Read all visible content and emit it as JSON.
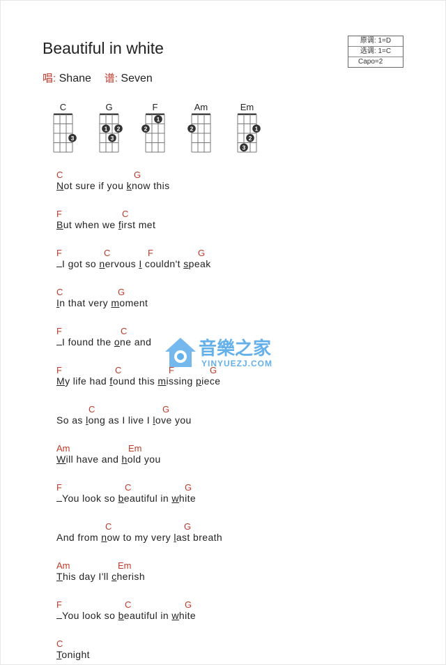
{
  "song": {
    "title": "Beautiful in white",
    "singer_label": "唱:",
    "singer": "Shane",
    "tab_label": "谱:",
    "tab_by": "Seven"
  },
  "key_info": {
    "original": "原调: 1=D",
    "selected": "选调: 1=C",
    "capo": "Capo=2"
  },
  "chord_diagrams": [
    {
      "name": "C",
      "fingers": [
        {
          "string": 4,
          "fret": 3,
          "finger": "3"
        }
      ]
    },
    {
      "name": "G",
      "fingers": [
        {
          "string": 2,
          "fret": 2,
          "finger": "1"
        },
        {
          "string": 4,
          "fret": 2,
          "finger": "2"
        },
        {
          "string": 3,
          "fret": 3,
          "finger": "3"
        }
      ]
    },
    {
      "name": "F",
      "fingers": [
        {
          "string": 3,
          "fret": 1,
          "finger": "1"
        },
        {
          "string": 1,
          "fret": 2,
          "finger": "2"
        }
      ]
    },
    {
      "name": "Am",
      "fingers": [
        {
          "string": 1,
          "fret": 2,
          "finger": "2"
        }
      ]
    },
    {
      "name": "Em",
      "fingers": [
        {
          "string": 4,
          "fret": 2,
          "finger": "1"
        },
        {
          "string": 3,
          "fret": 3,
          "finger": "2"
        },
        {
          "string": 2,
          "fret": 4,
          "finger": "3"
        }
      ]
    }
  ],
  "lyrics": [
    {
      "chords": [
        {
          "c": "C",
          "at": 0
        },
        {
          "c": "G",
          "at": 111
        }
      ],
      "segments": [
        {
          "t": "N",
          "u": true
        },
        {
          "t": "ot sure if you "
        },
        {
          "t": "k",
          "u": true
        },
        {
          "t": "now this"
        }
      ]
    },
    {
      "chords": [
        {
          "c": "F",
          "at": 0
        },
        {
          "c": "C",
          "at": 94
        }
      ],
      "segments": [
        {
          "t": "B",
          "u": true
        },
        {
          "t": "ut when we "
        },
        {
          "t": "f",
          "u": true
        },
        {
          "t": "irst met"
        }
      ]
    },
    {
      "chords": [
        {
          "c": "F",
          "at": 0
        },
        {
          "c": "C",
          "at": 68
        },
        {
          "c": "F",
          "at": 131
        },
        {
          "c": "G",
          "at": 203
        }
      ],
      "segments": [
        {
          "t": "",
          "dash": true
        },
        {
          "t": "I got so "
        },
        {
          "t": "n",
          "u": true
        },
        {
          "t": "ervous "
        },
        {
          "t": "I",
          "u": true
        },
        {
          "t": " couldn't "
        },
        {
          "t": "s",
          "u": true
        },
        {
          "t": "peak"
        }
      ]
    },
    {
      "chords": [
        {
          "c": "C",
          "at": 0
        },
        {
          "c": "G",
          "at": 88
        }
      ],
      "segments": [
        {
          "t": "I",
          "u": true
        },
        {
          "t": "n that very "
        },
        {
          "t": "m",
          "u": true
        },
        {
          "t": "oment"
        }
      ]
    },
    {
      "chords": [
        {
          "c": "F",
          "at": 0
        },
        {
          "c": "C",
          "at": 92
        }
      ],
      "segments": [
        {
          "t": "",
          "dash": true
        },
        {
          "t": "I found the "
        },
        {
          "t": "o",
          "u": true
        },
        {
          "t": "ne and"
        }
      ]
    },
    {
      "chords": [
        {
          "c": "F",
          "at": 0
        },
        {
          "c": "C",
          "at": 84
        },
        {
          "c": "F",
          "at": 161
        },
        {
          "c": "G",
          "at": 220
        }
      ],
      "segments": [
        {
          "t": "M",
          "u": true
        },
        {
          "t": "y life had "
        },
        {
          "t": "f",
          "u": true
        },
        {
          "t": "ound this "
        },
        {
          "t": "m",
          "u": true
        },
        {
          "t": "issing "
        },
        {
          "t": "p",
          "u": true
        },
        {
          "t": "iece"
        }
      ]
    },
    {
      "chords": [
        {
          "c": "C",
          "at": 46
        },
        {
          "c": "G",
          "at": 152
        }
      ],
      "segments": [
        {
          "t": "So as "
        },
        {
          "t": "l",
          "u": true
        },
        {
          "t": "ong as I live I "
        },
        {
          "t": "l",
          "u": true
        },
        {
          "t": "ove you"
        }
      ]
    },
    {
      "chords": [
        {
          "c": "Am",
          "at": 0
        },
        {
          "c": "Em",
          "at": 103
        }
      ],
      "segments": [
        {
          "t": "W",
          "u": true
        },
        {
          "t": "ill have and "
        },
        {
          "t": "h",
          "u": true
        },
        {
          "t": "old you"
        }
      ]
    },
    {
      "chords": [
        {
          "c": "F",
          "at": 0
        },
        {
          "c": "C",
          "at": 98
        },
        {
          "c": "G",
          "at": 184
        }
      ],
      "segments": [
        {
          "t": "",
          "dash": true
        },
        {
          "t": "You look so "
        },
        {
          "t": "b",
          "u": true
        },
        {
          "t": "eautiful in "
        },
        {
          "t": "w",
          "u": true
        },
        {
          "t": "hite"
        }
      ]
    },
    {
      "chords": [
        {
          "c": "C",
          "at": 70
        },
        {
          "c": "G",
          "at": 183
        }
      ],
      "segments": [
        {
          "t": "And from "
        },
        {
          "t": "n",
          "u": true
        },
        {
          "t": "ow to my very "
        },
        {
          "t": "l",
          "u": true
        },
        {
          "t": "ast breath"
        }
      ]
    },
    {
      "chords": [
        {
          "c": "Am",
          "at": 0
        },
        {
          "c": "Em",
          "at": 88
        }
      ],
      "segments": [
        {
          "t": "T",
          "u": true
        },
        {
          "t": "his day I'll "
        },
        {
          "t": "c",
          "u": true
        },
        {
          "t": "herish"
        }
      ]
    },
    {
      "chords": [
        {
          "c": "F",
          "at": 0
        },
        {
          "c": "C",
          "at": 98
        },
        {
          "c": "G",
          "at": 184
        }
      ],
      "segments": [
        {
          "t": "",
          "dash": true
        },
        {
          "t": "You look so "
        },
        {
          "t": "b",
          "u": true
        },
        {
          "t": "eautiful in "
        },
        {
          "t": "w",
          "u": true
        },
        {
          "t": "hite"
        }
      ]
    },
    {
      "chords": [
        {
          "c": "C",
          "at": 0
        }
      ],
      "segments": [
        {
          "t": "T",
          "u": true
        },
        {
          "t": "onight"
        }
      ]
    }
  ],
  "watermark": {
    "text_cn": "音樂之家",
    "text_en": "YINYUEZJ.COM",
    "color": "#4aa3e8"
  }
}
